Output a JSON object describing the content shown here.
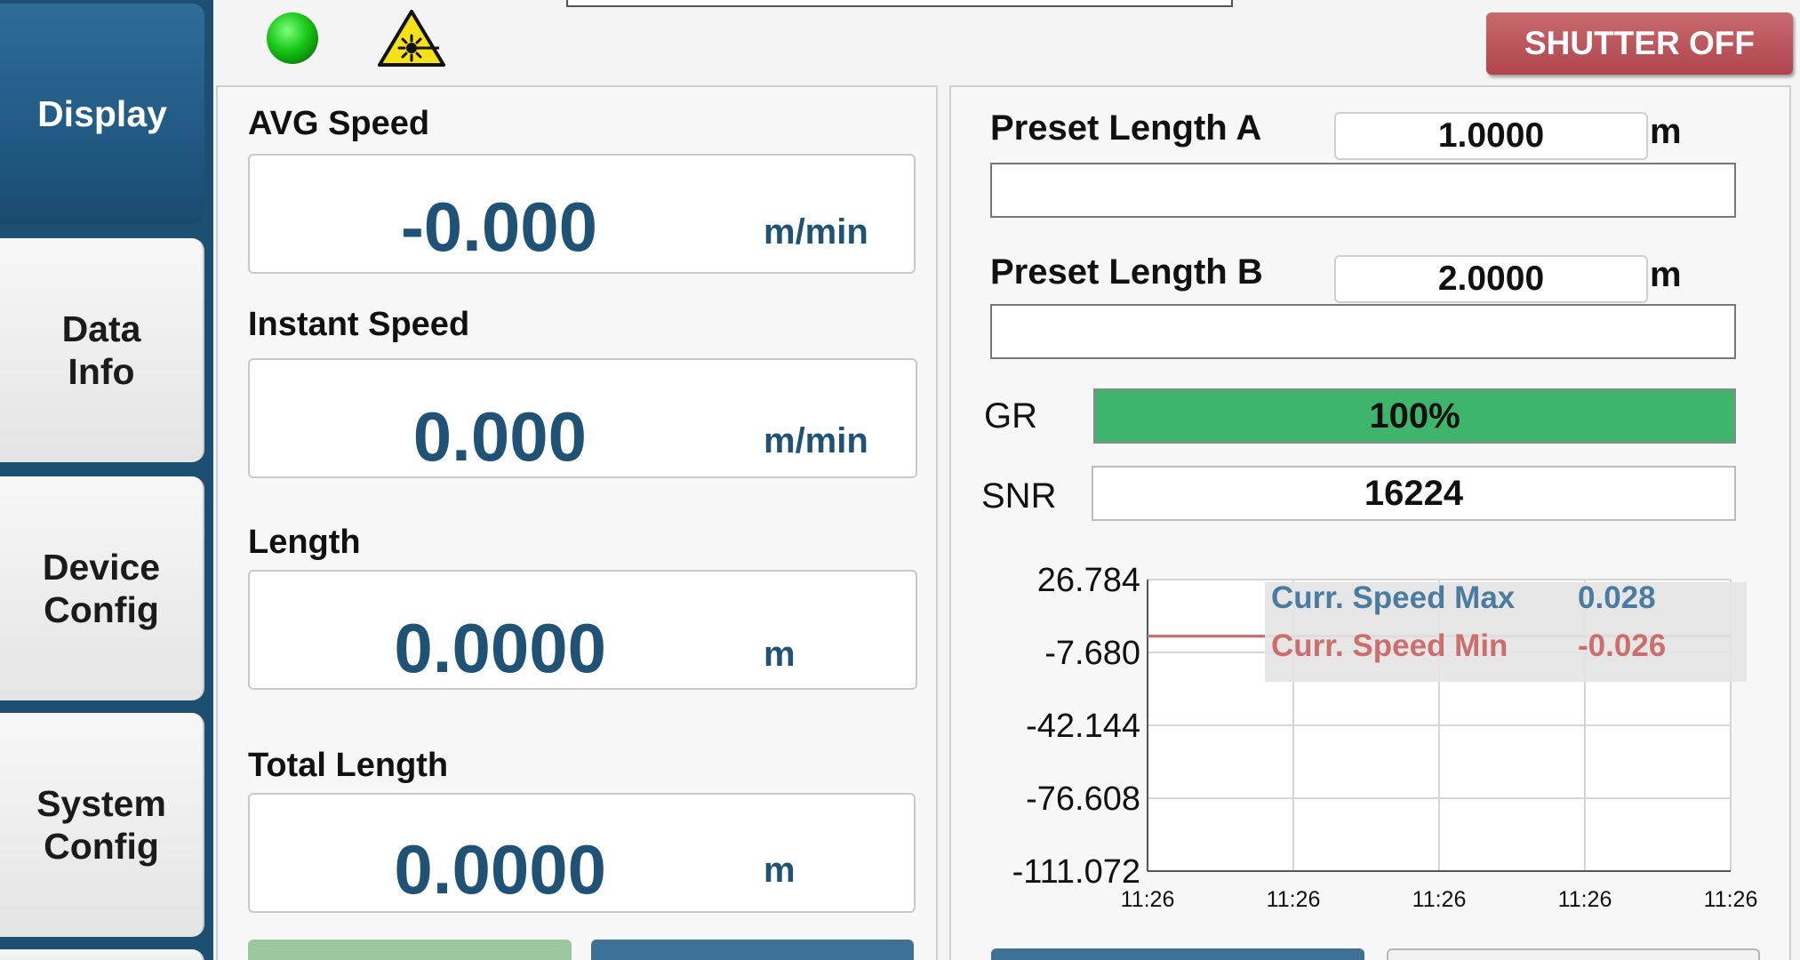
{
  "sidebar": {
    "items": [
      {
        "label": "Display",
        "active": true
      },
      {
        "label": "Data\nInfo",
        "active": false
      },
      {
        "label": "Device\nConfig",
        "active": false
      },
      {
        "label": "System\nConfig",
        "active": false
      }
    ]
  },
  "topbar": {
    "status_icon": "green-led-icon",
    "warning_icon": "laser-warning-icon",
    "shutter_label": "SHUTTER OFF"
  },
  "measurements": {
    "avg_speed": {
      "label": "AVG Speed",
      "value": "-0.000",
      "unit": "m/min"
    },
    "instant_speed": {
      "label": "Instant Speed",
      "value": "0.000",
      "unit": "m/min"
    },
    "length": {
      "label": "Length",
      "value": "0.0000",
      "unit": "m"
    },
    "total_length": {
      "label": "Total Length",
      "value": "0.0000",
      "unit": "m"
    }
  },
  "presets": {
    "a": {
      "label": "Preset Length A",
      "value": "1.0000",
      "unit": "m"
    },
    "b": {
      "label": "Preset Length B",
      "value": "2.0000",
      "unit": "m"
    }
  },
  "gauges": {
    "gr": {
      "label": "GR",
      "text": "100%",
      "percent": 100
    },
    "snr": {
      "label": "SNR",
      "value": "16224"
    }
  },
  "colors": {
    "sidebar": "#1d4f73",
    "accent_value": "#1f5274",
    "gr_fill": "#3fb46b",
    "shutter": "#b8525a",
    "series_max": "#4a7ba0",
    "series_min": "#cc6e6e"
  },
  "chart_data": {
    "type": "line",
    "x_ticks": [
      "11:26",
      "11:26",
      "11:26",
      "11:26",
      "11:26"
    ],
    "y_ticks": [
      "26.784",
      "-7.680",
      "-42.144",
      "-76.608",
      "-111.072"
    ],
    "ylim": [
      -111.072,
      26.784
    ],
    "grid": true,
    "legend_position": "top-right",
    "series": [
      {
        "name": "Curr. Speed Max",
        "value_label": "0.028",
        "values": [
          0.028,
          0.028
        ]
      },
      {
        "name": "Curr. Speed Min",
        "value_label": "-0.026",
        "values": [
          -0.026,
          -0.026
        ]
      }
    ]
  }
}
